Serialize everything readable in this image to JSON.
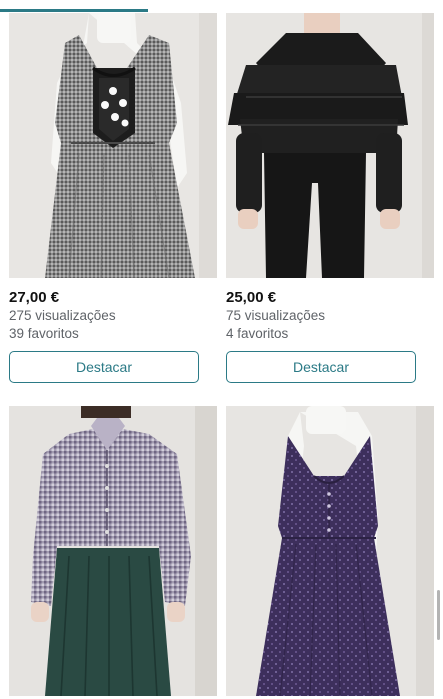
{
  "colors": {
    "accent": "#2b7a86",
    "muted_text": "#5f6368",
    "photo_background": "#e9e7e4"
  },
  "items": [
    {
      "price": "27,00 €",
      "views": "275 visualizações",
      "favorites": "39 favoritos",
      "boost_label": "Destacar",
      "photo_icon": "gingham-dirndl-dress-photo"
    },
    {
      "price": "25,00 €",
      "views": "75 visualizações",
      "favorites": "4 favoritos",
      "boost_label": "Destacar",
      "photo_icon": "black-ruffle-blouse-photo"
    },
    {
      "photo_icon": "checked-shirt-green-skirt-photo"
    },
    {
      "photo_icon": "purple-dirndl-dress-photo"
    }
  ]
}
